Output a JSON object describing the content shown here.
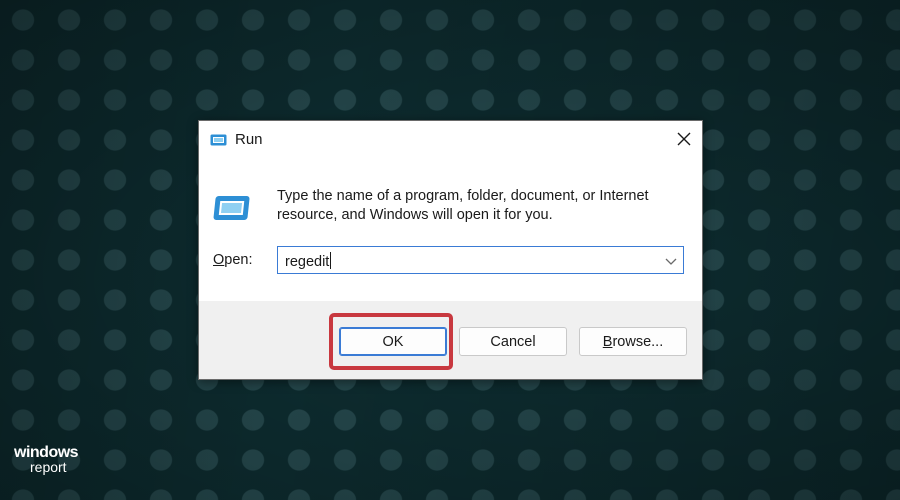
{
  "dialog": {
    "title": "Run",
    "description": "Type the name of a program, folder, document, or Internet resource, and Windows will open it for you.",
    "open_label_mnemonic": "O",
    "open_label_rest": "pen:",
    "open_value": "regedit",
    "buttons": {
      "ok": "OK",
      "cancel": "Cancel",
      "browse_mnemonic": "B",
      "browse_rest": "rowse..."
    },
    "icons": {
      "title": "run-icon",
      "close": "close-icon",
      "large": "run-icon",
      "dropdown": "chevron-down-icon"
    }
  },
  "annotation": {
    "highlight_color": "#c8383f"
  },
  "watermark": {
    "line1": "windows",
    "line2": "report"
  }
}
